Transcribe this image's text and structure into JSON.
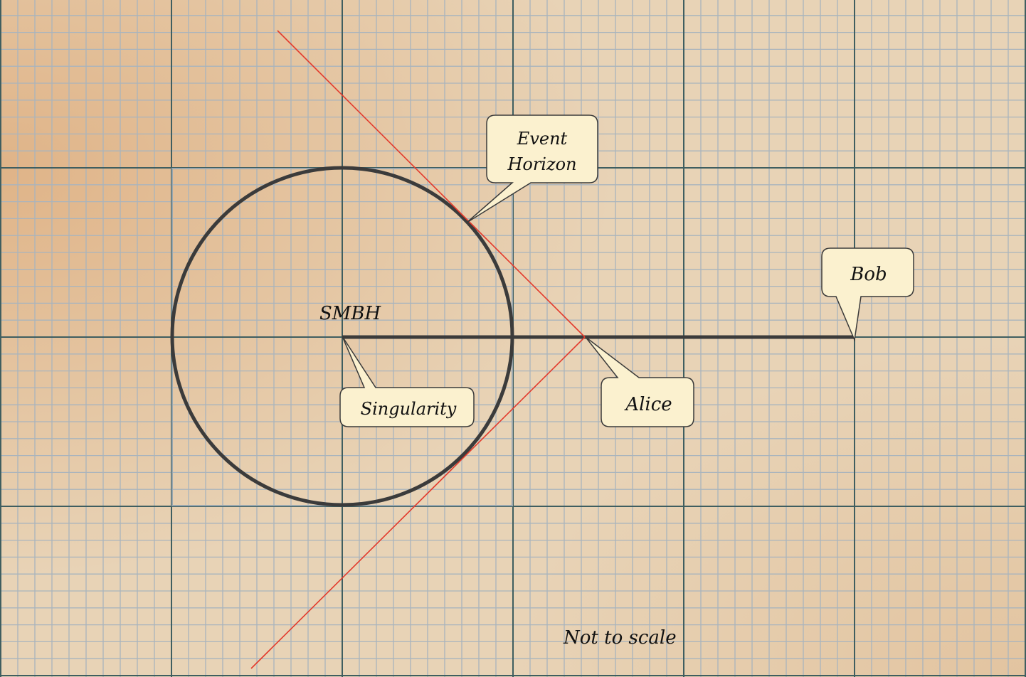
{
  "labels": {
    "smbh": "SMBH",
    "event_horizon_line1": "Event",
    "event_horizon_line2": "Horizon",
    "bob": "Bob",
    "singularity": "Singularity",
    "alice": "Alice",
    "note": "Not to scale"
  },
  "colors": {
    "paper": "#e8d3b6",
    "paper_shade": "#d9a06a",
    "minor_grid": "#a9b4bd",
    "major_grid": "#3f5e60",
    "ink": "#3b3b3b",
    "light_ray": "#e33a2c",
    "callout_fill": "#fbf1cf",
    "callout_stroke": "#3a3a3a"
  }
}
